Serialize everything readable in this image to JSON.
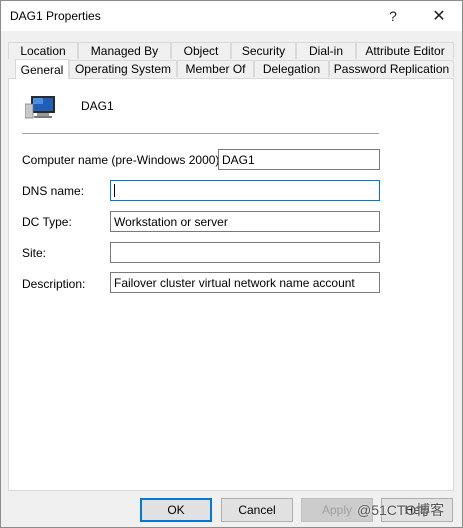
{
  "window": {
    "title": "DAG1 Properties",
    "help_button": "?",
    "close_button": "✕"
  },
  "tabs_row1": [
    "Location",
    "Managed By",
    "Object",
    "Security",
    "Dial-in",
    "Attribute Editor"
  ],
  "tabs_row2": [
    "General",
    "Operating System",
    "Member Of",
    "Delegation",
    "Password Replication"
  ],
  "active_tab": "General",
  "object": {
    "name": "DAG1",
    "icon": "computer-icon"
  },
  "fields": {
    "computer_name": {
      "label": "Computer name (pre-Windows 2000):",
      "value": "DAG1"
    },
    "dns_name": {
      "label": "DNS name:",
      "value": ""
    },
    "dc_type": {
      "label": "DC Type:",
      "value": "Workstation or server"
    },
    "site": {
      "label": "Site:",
      "value": ""
    },
    "description": {
      "label": "Description:",
      "value": "Failover cluster virtual network name account"
    }
  },
  "buttons": {
    "ok": "OK",
    "cancel": "Cancel",
    "apply": "Apply",
    "help": "Help"
  },
  "watermark": "@51CTO博客",
  "colors": {
    "focus_border": "#0078d7",
    "monitor_screen": "#1f5fb8"
  }
}
